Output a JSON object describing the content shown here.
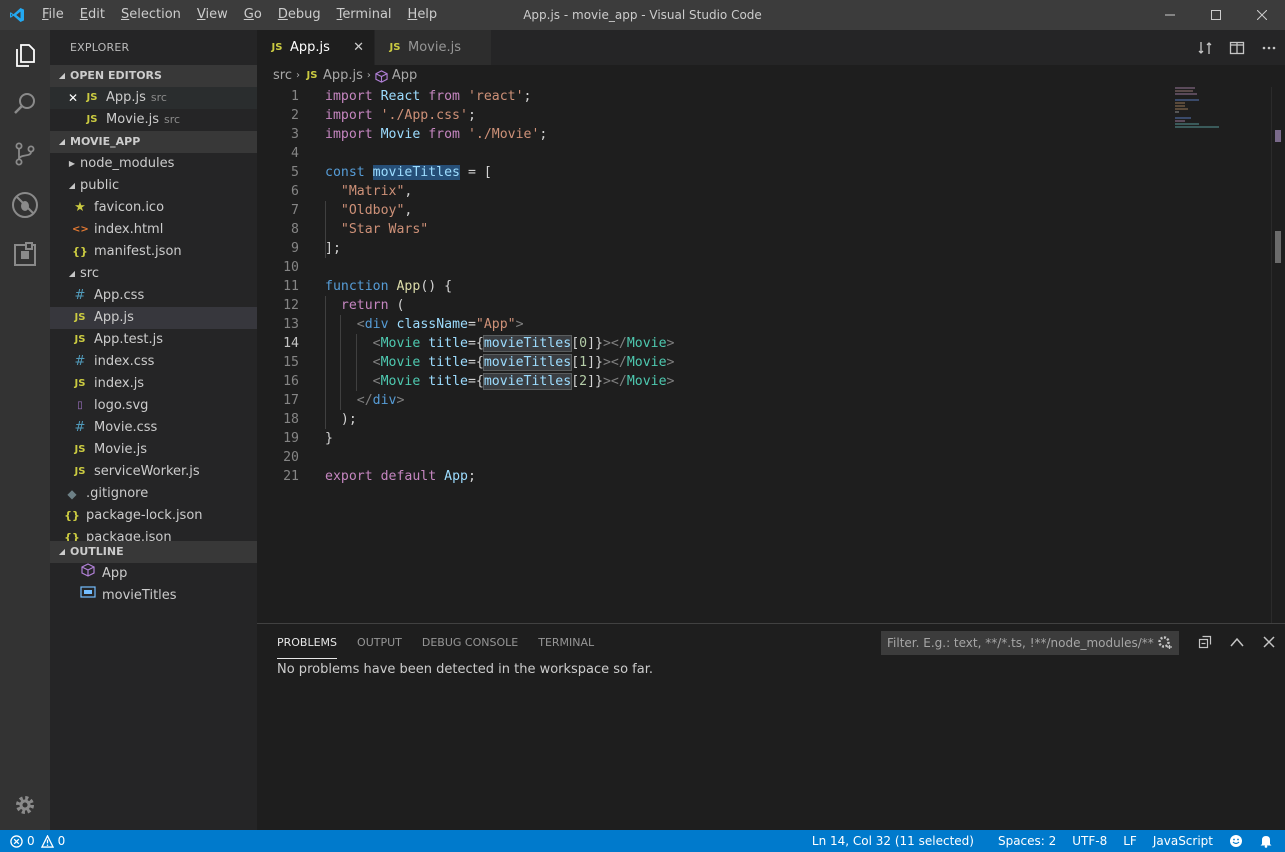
{
  "window": {
    "title": "App.js - movie_app - Visual Studio Code",
    "menu": [
      {
        "first": "F",
        "rest": "ile"
      },
      {
        "first": "E",
        "rest": "dit"
      },
      {
        "first": "S",
        "rest": "election"
      },
      {
        "first": "V",
        "rest": "iew"
      },
      {
        "first": "G",
        "rest": "o"
      },
      {
        "first": "D",
        "rest": "ebug"
      },
      {
        "first": "T",
        "rest": "erminal"
      },
      {
        "first": "H",
        "rest": "elp"
      }
    ]
  },
  "sidebar": {
    "title": "EXPLORER",
    "open_editors_header": "OPEN EDITORS",
    "open_editors": [
      {
        "icon": "JS",
        "name": "App.js",
        "desc": "src",
        "close": "✕"
      },
      {
        "icon": "JS",
        "name": "Movie.js",
        "desc": "src"
      }
    ],
    "project_header": "MOVIE_APP",
    "tree": [
      {
        "name": "node_modules",
        "twisty": "▶"
      },
      {
        "name": "public",
        "twisty": "◢"
      },
      {
        "name": "favicon.ico",
        "icon": "★"
      },
      {
        "name": "index.html",
        "icon": "<>"
      },
      {
        "name": "manifest.json",
        "icon": "{}"
      },
      {
        "name": "src",
        "twisty": "◢"
      },
      {
        "name": "App.css",
        "icon": "#"
      },
      {
        "name": "App.js",
        "icon": "JS"
      },
      {
        "name": "App.test.js",
        "icon": "JS"
      },
      {
        "name": "index.css",
        "icon": "#"
      },
      {
        "name": "index.js",
        "icon": "JS"
      },
      {
        "name": "logo.svg",
        "icon": "▯"
      },
      {
        "name": "Movie.css",
        "icon": "#"
      },
      {
        "name": "Movie.js",
        "icon": "JS"
      },
      {
        "name": "serviceWorker.js",
        "icon": "JS"
      },
      {
        "name": ".gitignore",
        "icon": "◆"
      },
      {
        "name": "package-lock.json",
        "icon": "{}"
      },
      {
        "name": "package.json",
        "icon": "{}"
      }
    ],
    "outline_header": "OUTLINE",
    "outline": [
      {
        "name": "App"
      },
      {
        "name": "movieTitles"
      }
    ]
  },
  "editor": {
    "tabs": [
      {
        "icon": "JS",
        "label": "App.js",
        "close": "✕"
      },
      {
        "icon": "JS",
        "label": "Movie.js"
      }
    ],
    "breadcrumb": {
      "folder": "src",
      "file": "App.js",
      "symbol": "App"
    },
    "line_numbers": [
      "1",
      "2",
      "3",
      "4",
      "5",
      "6",
      "7",
      "8",
      "9",
      "10",
      "11",
      "12",
      "13",
      "14",
      "15",
      "16",
      "17",
      "18",
      "19",
      "20",
      "21"
    ],
    "current_line": 14,
    "code": {
      "l1": [
        "import",
        " React ",
        "from",
        " ",
        "'react'",
        ";"
      ],
      "l2": [
        "import",
        " ",
        "'./App.css'",
        ";"
      ],
      "l3": [
        "import",
        " Movie ",
        "from",
        " ",
        "'./Movie'",
        ";"
      ],
      "l5": [
        "const",
        " ",
        "movieTitles",
        " = ["
      ],
      "l6": "\"Matrix\"",
      "l7": "\"Oldboy\"",
      "l8": "\"Star Wars\"",
      "l9": "];",
      "l11": [
        "function",
        " ",
        "App",
        "() {"
      ],
      "l12": [
        "return",
        " ("
      ],
      "l13": [
        "<",
        "div",
        " ",
        "className",
        "=",
        "\"App\"",
        ">"
      ],
      "movie_rows": [
        {
          "idx": "0"
        },
        {
          "idx": "1"
        },
        {
          "idx": "2"
        }
      ],
      "movie_tag": "Movie",
      "title_attr": "title",
      "array_name": "movieTitles",
      "l17": [
        "</",
        "div",
        ">"
      ],
      "l18": ");",
      "l19": "}",
      "l21": [
        "export",
        " ",
        "default",
        " ",
        "App",
        ";"
      ]
    }
  },
  "panel": {
    "tabs": [
      "PROBLEMS",
      "OUTPUT",
      "DEBUG CONSOLE",
      "TERMINAL"
    ],
    "filter_placeholder": "Filter. E.g.: text, **/*.ts, !**/node_modules/**",
    "message": "No problems have been detected in the workspace so far."
  },
  "statusbar": {
    "errors": "0",
    "warnings": "0",
    "position": "Ln 14, Col 32 (11 selected)",
    "spaces": "Spaces: 2",
    "encoding": "UTF-8",
    "eol": "LF",
    "language": "JavaScript"
  }
}
